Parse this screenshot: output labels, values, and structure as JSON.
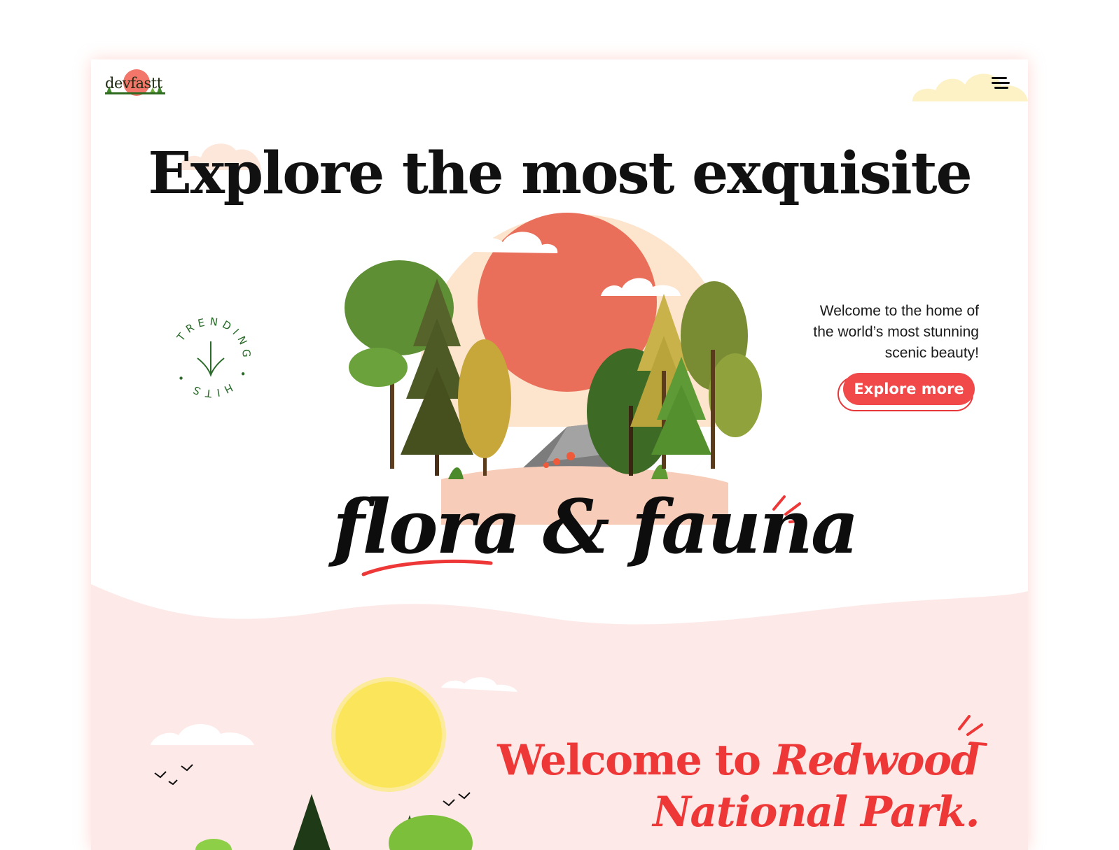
{
  "brand": {
    "name": "devfastt"
  },
  "header": {
    "menu_icon": "hamburger-menu-icon"
  },
  "hero": {
    "headline": "Explore the most exquisite",
    "script_text": "flora & fauna",
    "badge_text": "TRENDING • HITS •",
    "badge_icon": "arrow-down-sprout-icon",
    "intro_lines": [
      "Welcome to the home of",
      "the world’s most stunning",
      "scenic beauty!"
    ],
    "cta_label": "Explore more"
  },
  "section2": {
    "title_plain": "Welcome to ",
    "title_italic_1": "Redwood",
    "title_italic_2": "National Park."
  },
  "colors": {
    "accent": "#f1494a",
    "sun": "#e96f5a",
    "pale_pink": "#fde9e7",
    "peach": "#fde4cc",
    "forest_green": "#4c7a2c",
    "cloud_yellow": "#fdf1c6"
  }
}
